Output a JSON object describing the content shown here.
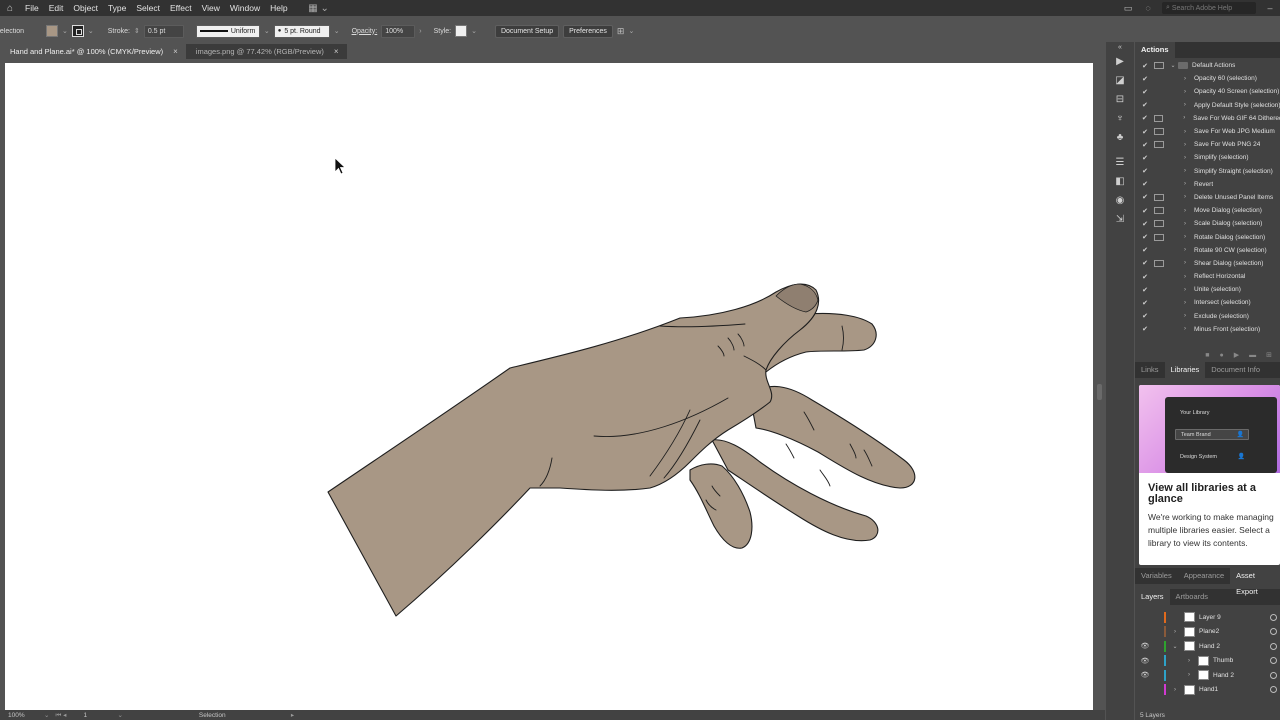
{
  "menubar": {
    "items": [
      "File",
      "Edit",
      "Object",
      "Type",
      "Select",
      "Effect",
      "View",
      "Window",
      "Help"
    ],
    "search_placeholder": "Search Adobe Help"
  },
  "controlbar": {
    "selection_label": "Selection",
    "fill_color": "#a89785",
    "stroke_label": "Stroke:",
    "stroke_value": "0.5 pt",
    "profile_label": "Uniform",
    "brush_label": "5 pt. Round",
    "opacity_label": "Opacity:",
    "opacity_value": "100%",
    "style_label": "Style:",
    "document_setup": "Document Setup",
    "preferences": "Preferences"
  },
  "tabs": [
    {
      "label": "Hand and Plane.ai* @ 100% (CMYK/Preview)",
      "active": true
    },
    {
      "label": "images.png @ 77.42% (RGB/Preview)",
      "active": false
    }
  ],
  "artwork": {
    "fill": "#a89785",
    "thumbnail_fill": "#8f7f70",
    "stroke": "#1e1e1e"
  },
  "statusbar": {
    "zoom": "100%",
    "artboard": "1",
    "tool": "Selection"
  },
  "actions_panel": {
    "title": "Actions",
    "set_name": "Default Actions",
    "items": [
      {
        "label": "Opacity 60 (selection)",
        "dialog": false
      },
      {
        "label": "Opacity 40 Screen (selection)",
        "dialog": false
      },
      {
        "label": "Apply Default Style (selection)",
        "dialog": false
      },
      {
        "label": "Save For Web GIF 64 Dithered",
        "dialog": true
      },
      {
        "label": "Save For Web JPG Medium",
        "dialog": true
      },
      {
        "label": "Save For Web PNG 24",
        "dialog": true
      },
      {
        "label": "Simplify (selection)",
        "dialog": false
      },
      {
        "label": "Simplify Straight (selection)",
        "dialog": false
      },
      {
        "label": "Revert",
        "dialog": false
      },
      {
        "label": "Delete Unused Panel Items",
        "dialog": true
      },
      {
        "label": "Move Dialog (selection)",
        "dialog": true
      },
      {
        "label": "Scale Dialog (selection)",
        "dialog": true
      },
      {
        "label": "Rotate Dialog (selection)",
        "dialog": true
      },
      {
        "label": "Rotate 90 CW (selection)",
        "dialog": false
      },
      {
        "label": "Shear Dialog (selection)",
        "dialog": true
      },
      {
        "label": "Reflect Horizontal",
        "dialog": false
      },
      {
        "label": "Unite (selection)",
        "dialog": false
      },
      {
        "label": "Intersect (selection)",
        "dialog": false
      },
      {
        "label": "Exclude (selection)",
        "dialog": false
      },
      {
        "label": "Minus Front (selection)",
        "dialog": false
      }
    ]
  },
  "libraries_panel": {
    "tabs": [
      "Links",
      "Libraries",
      "Document Info"
    ],
    "active_tab": "Libraries",
    "preview_rows": [
      "Your Library",
      "Team Brand",
      "Design System"
    ],
    "title": "View all libraries at a glance",
    "desc_lines": [
      "We're working to make managing",
      "multiple libraries easier. Select a",
      "library to view its contents."
    ]
  },
  "appearance_tabs": {
    "tabs": [
      "Variables",
      "Appearance",
      "Asset Export"
    ],
    "active_tab": "Asset Export"
  },
  "layers_panel": {
    "tabs": [
      "Layers",
      "Artboards"
    ],
    "active_tab": "Layers",
    "rows": [
      {
        "name": "Layer 9",
        "visible": false,
        "color": "#e06a1d",
        "indent": 0,
        "expand": ""
      },
      {
        "name": "Plane2",
        "visible": false,
        "color": "#8a5a3a",
        "indent": 0,
        "expand": "›"
      },
      {
        "name": "Hand 2",
        "visible": true,
        "color": "#2ea22e",
        "indent": 0,
        "expand": "⌄"
      },
      {
        "name": "Thumb",
        "visible": true,
        "color": "#2ea2c8",
        "indent": 1,
        "expand": "›"
      },
      {
        "name": "Hand 2",
        "visible": true,
        "color": "#2ea2c8",
        "indent": 1,
        "expand": "›"
      },
      {
        "name": "Hand1",
        "visible": false,
        "color": "#d23ad2",
        "indent": 0,
        "expand": "›"
      }
    ],
    "footer": "5 Layers"
  }
}
